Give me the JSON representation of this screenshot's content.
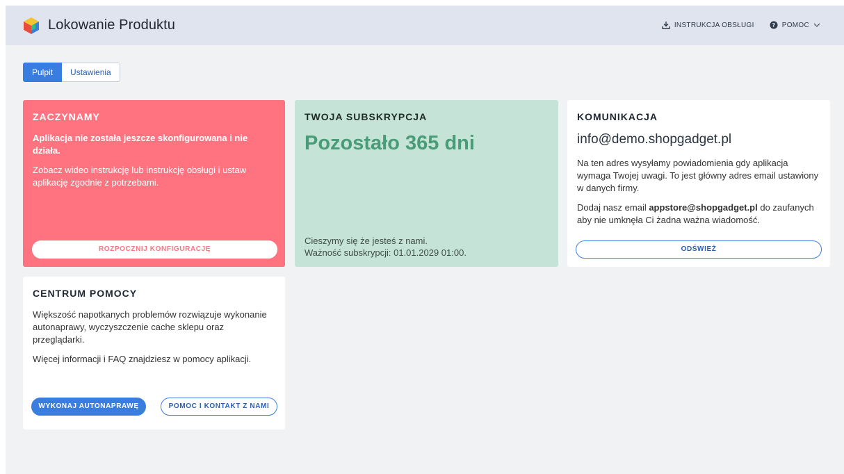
{
  "header": {
    "app_title": "Lokowanie Produktu",
    "manual_label": "INSTRUKCJA OBSŁUGI",
    "help_label": "POMOC",
    "icons": {
      "logo": "app-logo-cube",
      "manual": "download-icon",
      "help": "question-circle-icon",
      "dropdown": "chevron-down-icon"
    }
  },
  "tabs": [
    {
      "label": "Pulpit",
      "active": true
    },
    {
      "label": "Ustawienia",
      "active": false
    }
  ],
  "cards": {
    "start": {
      "title": "ZACZYNAMY",
      "warning": "Aplikacja nie została jeszcze skonfigurowana i nie działa.",
      "description": "Zobacz wideo instrukcję lub instrukcję obsługi i ustaw aplikację zgodnie z potrzebami.",
      "button": "ROZPOCZNIJ KONFIGURACJĘ"
    },
    "subscription": {
      "title": "TWOJA SUBSKRYPCJA",
      "remaining": "Pozostało 365 dni",
      "footer_line1": "Cieszymy się że jesteś z nami.",
      "footer_line2": "Ważność subskrypcji: 01.01.2029 01:00."
    },
    "communication": {
      "title": "KOMUNIKACJA",
      "email": "info@demo.shopgadget.pl",
      "info": "Na ten adres wysyłamy powiadomienia gdy aplikacja wymaga Twojej uwagi. To jest główny adres email ustawiony w danych firmy.",
      "trust_prefix": "Dodaj nasz email ",
      "trust_email": "appstore@shopgadget.pl",
      "trust_suffix": " do zaufanych aby nie umknęła Ci żadna ważna wiadomość.",
      "button": "ODŚWIEŻ"
    },
    "help": {
      "title": "CENTRUM POMOCY",
      "text1": "Większość napotkanych problemów rozwiązuje wykonanie autonaprawy, wyczyszczenie cache sklepu oraz przeglądarki.",
      "text2": "Więcej informacji i FAQ znajdziesz w pomocy aplikacji.",
      "button_autorepair": "WYKONAJ AUTONAPRAWĘ",
      "button_contact": "POMOC I KONTAKT Z NAMI"
    }
  },
  "colors": {
    "accent_blue": "#3a7de0",
    "start_card": "#ff7381",
    "subscription_card": "#c5e4d7",
    "subscription_text": "#4a9c78",
    "header_bg": "#dfe4ee",
    "page_bg": "#f1f2f4"
  }
}
